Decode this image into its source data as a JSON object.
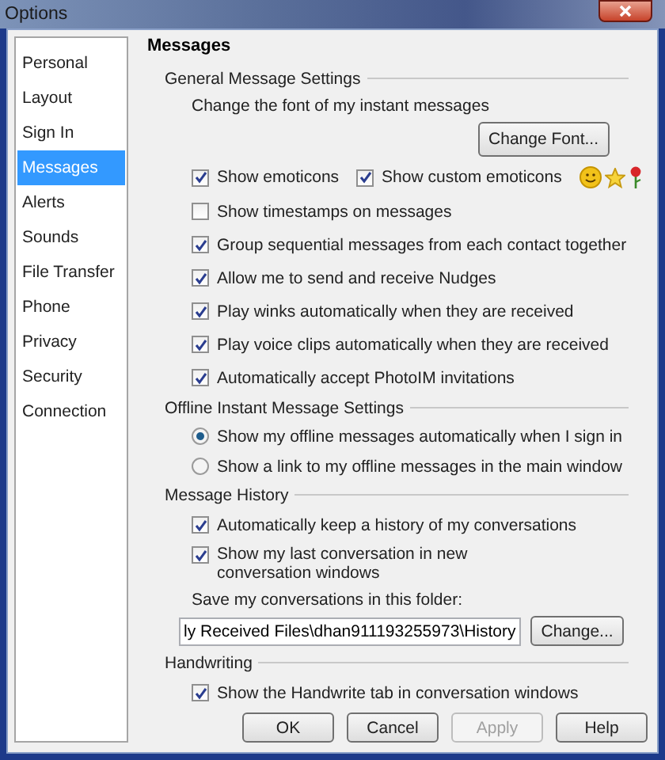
{
  "window": {
    "title": "Options"
  },
  "sidebar": {
    "items": [
      {
        "label": "Personal",
        "selected": false
      },
      {
        "label": "Layout",
        "selected": false
      },
      {
        "label": "Sign In",
        "selected": false
      },
      {
        "label": "Messages",
        "selected": true
      },
      {
        "label": "Alerts",
        "selected": false
      },
      {
        "label": "Sounds",
        "selected": false
      },
      {
        "label": "File Transfer",
        "selected": false
      },
      {
        "label": "Phone",
        "selected": false
      },
      {
        "label": "Privacy",
        "selected": false
      },
      {
        "label": "Security",
        "selected": false
      },
      {
        "label": "Connection",
        "selected": false
      }
    ]
  },
  "page_title": "Messages",
  "sections": [
    {
      "title": "General Message Settings",
      "items": [
        {
          "kind": "text",
          "label": "Change the font of my instant messages"
        },
        {
          "kind": "button",
          "label": "Change Font..."
        },
        {
          "kind": "checkbox_pair",
          "boxes": [
            {
              "label": "Show emoticons",
              "checked": true
            },
            {
              "label": "Show custom emoticons",
              "checked": true
            }
          ]
        },
        {
          "kind": "checkbox",
          "label": "Show timestamps on messages",
          "checked": false
        },
        {
          "kind": "checkbox",
          "label": "Group sequential messages from each contact together",
          "checked": true
        },
        {
          "kind": "checkbox",
          "label": "Allow me to send and receive Nudges",
          "checked": true
        },
        {
          "kind": "checkbox",
          "label": "Play winks automatically when they are received",
          "checked": true
        },
        {
          "kind": "checkbox",
          "label": "Play voice clips automatically when they are received",
          "checked": true
        },
        {
          "kind": "checkbox",
          "label": "Automatically accept PhotoIM invitations",
          "checked": true
        }
      ]
    },
    {
      "title": "Offline Instant Message Settings",
      "items": [
        {
          "kind": "radio",
          "label": "Show my offline messages automatically when I sign in",
          "selected": true
        },
        {
          "kind": "radio",
          "label": "Show a link to my offline messages in the main window",
          "selected": false
        }
      ]
    },
    {
      "title": "Message History",
      "items": [
        {
          "kind": "checkbox",
          "label": "Automatically keep a history of my conversations",
          "checked": true
        },
        {
          "kind": "checkbox_narrow",
          "label": "Show my last conversation in new conversation windows",
          "checked": true
        },
        {
          "kind": "text",
          "label": "Save my conversations in this folder:"
        },
        {
          "kind": "folder",
          "value": "ly Received Files\\dhan911193255973\\History",
          "button": "Change..."
        }
      ]
    },
    {
      "title": "Handwriting",
      "items": [
        {
          "kind": "checkbox",
          "label": "Show the Handwrite tab in conversation windows",
          "checked": true
        }
      ]
    }
  ],
  "buttons": [
    {
      "label": "OK",
      "disabled": false
    },
    {
      "label": "Cancel",
      "disabled": false
    },
    {
      "label": "Apply",
      "disabled": true
    },
    {
      "label": "Help",
      "disabled": false
    }
  ]
}
